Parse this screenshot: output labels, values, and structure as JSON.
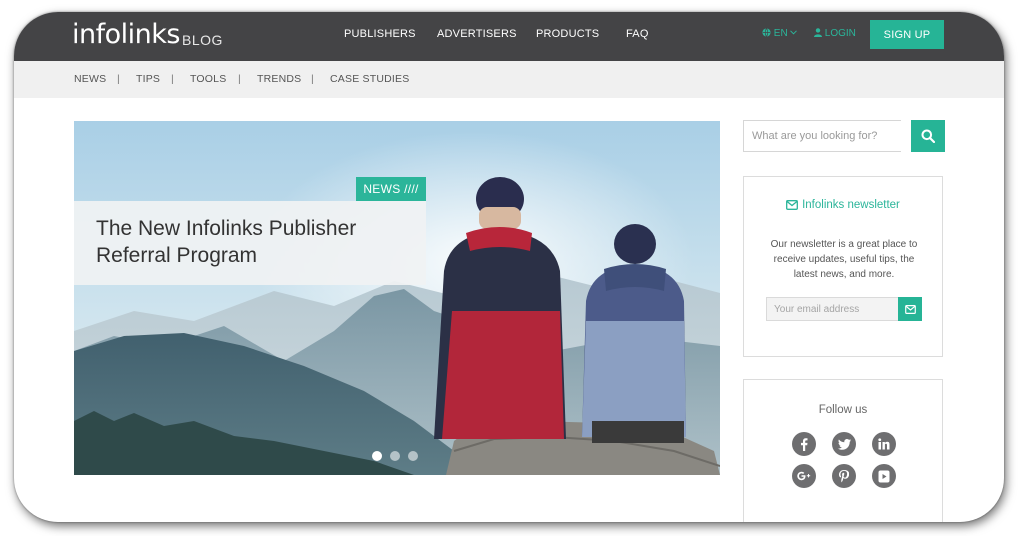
{
  "header": {
    "logo_text": "infolinks",
    "logo_sub": "BLOG",
    "nav": [
      "PUBLISHERS",
      "ADVERTISERS",
      "PRODUCTS",
      "FAQ"
    ],
    "language": "EN",
    "login": "LOGIN",
    "signup": "SIGN UP"
  },
  "subnav": {
    "items": [
      "NEWS",
      "TIPS",
      "TOOLS",
      "TRENDS",
      "CASE STUDIES"
    ],
    "separator": "|"
  },
  "hero": {
    "badge": "NEWS ////",
    "title": "The New Infolinks Publisher Referral Program",
    "slides_total": 3,
    "active_slide": 1
  },
  "search": {
    "placeholder": "What are you looking for?",
    "icon": "search-icon"
  },
  "newsletter": {
    "title": "Infolinks newsletter",
    "description": "Our newsletter is a great place to receive updates, useful tips, the latest news, and more.",
    "email_placeholder": "Your email address",
    "icon": "envelope-icon"
  },
  "follow": {
    "title": "Follow us",
    "networks": [
      "facebook",
      "twitter",
      "linkedin",
      "google-plus",
      "pinterest",
      "youtube"
    ]
  },
  "colors": {
    "accent": "#26b496",
    "header_bg": "#444446",
    "subnav_bg": "#f0f0f0"
  }
}
